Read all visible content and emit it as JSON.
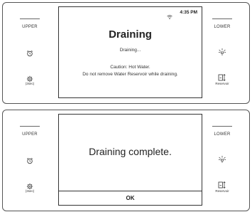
{
  "panels": [
    {
      "side_left": {
        "label": "UPPER",
        "alarm_icon": "alarm-clock-icon",
        "settings_icon": "gear-icon",
        "settings_caption": "(3sec)"
      },
      "side_right": {
        "label": "LOWER",
        "light_icon": "light-icon",
        "reservoir_icon": "reservoir-icon",
        "reservoir_caption": "Reservoir"
      },
      "screen": {
        "status": {
          "wifi_icon": "wifi-icon",
          "time": "4:35 PM"
        },
        "title": "Draining",
        "subtitle": "Draining...",
        "caution_line1": "Caution: Hot Water.",
        "caution_line2": "Do not remove Water Reservoir while draining."
      }
    },
    {
      "side_left": {
        "label": "UPPER",
        "alarm_icon": "alarm-clock-icon",
        "settings_icon": "gear-icon",
        "settings_caption": "(3sec)"
      },
      "side_right": {
        "label": "LOWER",
        "light_icon": "light-icon",
        "reservoir_icon": "reservoir-icon",
        "reservoir_caption": "Reservoir"
      },
      "screen": {
        "message": "Draining complete.",
        "ok_label": "OK"
      }
    }
  ]
}
